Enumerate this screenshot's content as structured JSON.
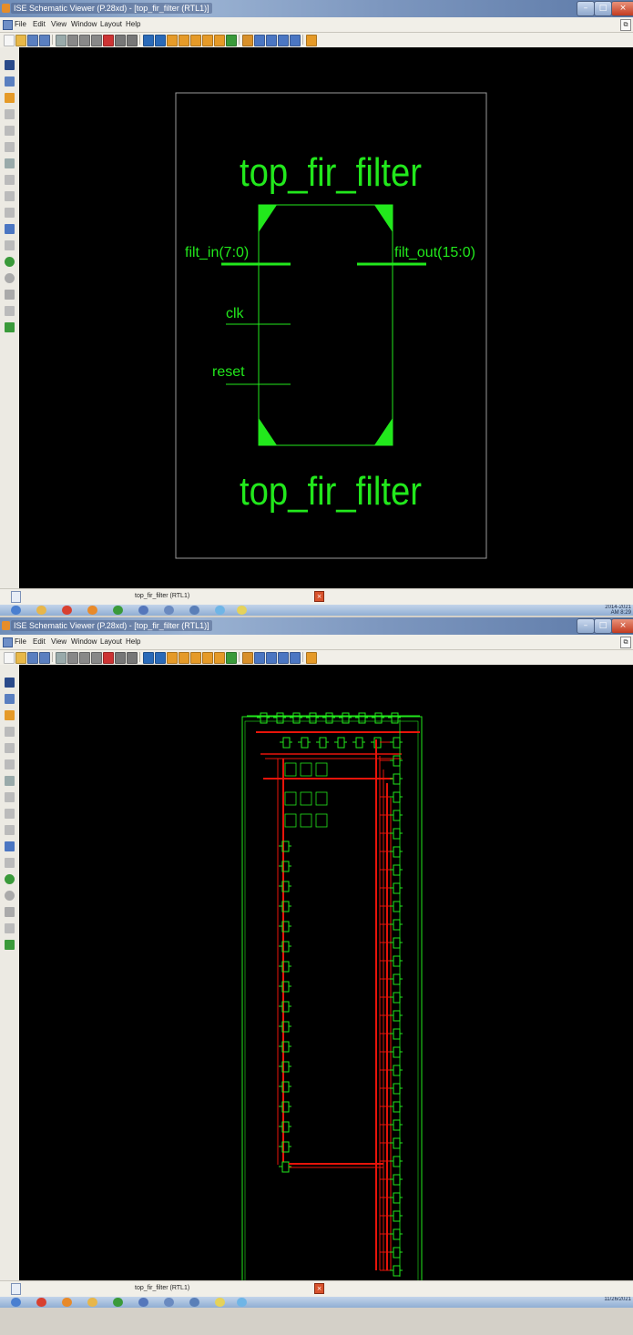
{
  "windows": [
    {
      "title": "ISE Schematic Viewer (P.28xd) - [top_fir_filter (RTL1)]",
      "menu": [
        "File",
        "Edit",
        "View",
        "Window",
        "Layout",
        "Help"
      ],
      "tab_label": "top_fir_filter (RTL1)",
      "clock": "2014-2021",
      "clock_line2": "AM 8:29",
      "schematic": {
        "view": "symbol",
        "module_name_top": "top_fir_filter",
        "module_name_bottom": "top_fir_filter",
        "ports_left": [
          "filt_in(7:0)",
          "clk",
          "reset"
        ],
        "ports_right": [
          "filt_out(15:0)"
        ]
      }
    },
    {
      "title": "ISE Schematic Viewer (P.28xd) - [top_fir_filter (RTL1)]",
      "menu": [
        "File",
        "Edit",
        "View",
        "Window",
        "Layout",
        "Help"
      ],
      "tab_label": "top_fir_filter (RTL1)",
      "clock": "11/26/2021",
      "schematic": {
        "view": "rtl-netlist"
      }
    }
  ],
  "colors": {
    "schematic_green": "#22e81c",
    "net_red": "#e8140a",
    "canvas_bg": "#000000",
    "border_gray": "#9a9a9a"
  },
  "icons": {
    "toolbar": [
      "new-icon",
      "open-icon",
      "save-icon",
      "save-all-icon",
      "print-icon",
      "cut-icon",
      "copy-icon",
      "paste-icon",
      "delete-icon",
      "undo-icon",
      "redo-icon",
      "find-icon",
      "find-next-icon",
      "zoom-in-icon",
      "zoom-out-icon",
      "zoom-full-icon",
      "zoom-fit-icon",
      "zoom-select-icon",
      "refresh-icon",
      "window-icon",
      "tile-icon",
      "cascade-icon",
      "split-icon",
      "arrange-icon",
      "help-icon"
    ],
    "left": [
      "select-arrow-icon",
      "zoom-area-icon",
      "add-icon",
      "forward-icon",
      "back-icon",
      "expand-icon",
      "collapse-icon",
      "hierarchy-icon",
      "print-preview-icon",
      "rubber-band-icon",
      "find-net-icon",
      "mark-icon",
      "green-circle-icon",
      "gray-circle-icon",
      "sync-icon",
      "info-icon",
      "green-shield-icon"
    ]
  }
}
